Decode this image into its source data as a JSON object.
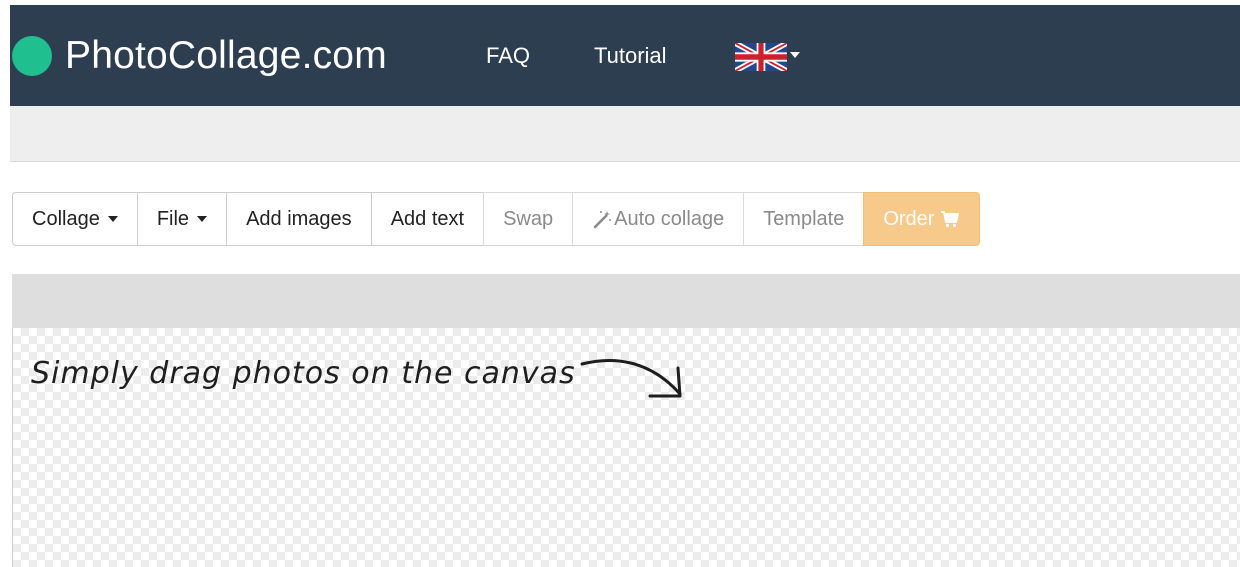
{
  "navbar": {
    "brand": "PhotoCollage.com",
    "links": [
      "FAQ",
      "Tutorial"
    ],
    "language_icon": "uk-flag-icon"
  },
  "toolbar": {
    "collage": "Collage",
    "file": "File",
    "add_images": "Add images",
    "add_text": "Add text",
    "swap": "Swap",
    "auto_collage": "Auto collage",
    "template": "Template",
    "order": "Order"
  },
  "canvas": {
    "hint": "Simply drag photos on the canvas"
  },
  "colors": {
    "navbar": "#2d3e50",
    "brand_dot": "#1fbf8f",
    "order_button": "#f7c98a"
  }
}
